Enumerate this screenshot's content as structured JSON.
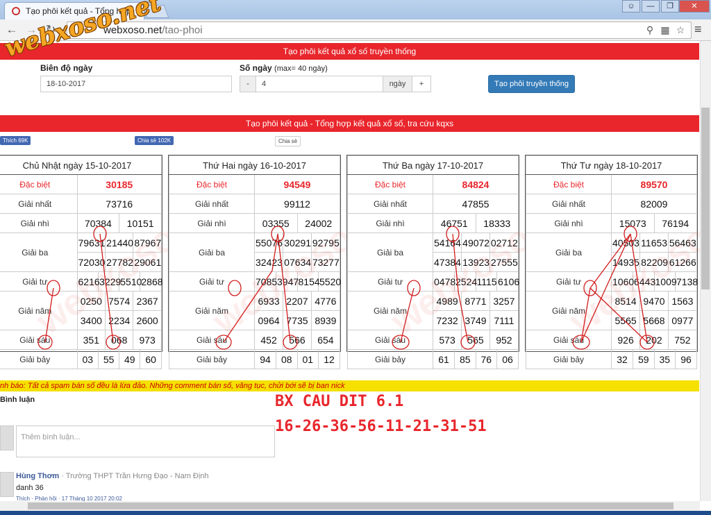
{
  "browser": {
    "tab_title": "Tạo phôi kết quả - Tổng hợp",
    "url_host": "webxoso.net",
    "url_path": "/tao-phoi"
  },
  "form": {
    "banner": "Tạo phôi kết quả xổ số truyền thống",
    "range_label": "Biên độ ngày",
    "range_value": "18-10-2017",
    "days_label": "Số ngày",
    "days_hint": "(max= 40 ngày)",
    "minus": "-",
    "days_value": "4",
    "days_unit": "ngày",
    "plus": "+",
    "submit": "Tạo phôi truyền thống"
  },
  "results_banner": "Tạo phôi kết quả - Tổng hợp kết quả xổ số, tra cứu kqxs",
  "social": {
    "like": "Thích 69K",
    "share": "Chia sẻ 102K",
    "gshare": "Chia sẻ"
  },
  "prize_labels": {
    "db": "Đặc biệt",
    "g1": "Giải nhất",
    "g2": "Giải nhì",
    "g3": "Giải ba",
    "g4": "Giải tư",
    "g5": "Giải năm",
    "g6": "Giải sáu",
    "g7": "Giải bảy"
  },
  "days": [
    {
      "title": "Chủ Nhật ngày 15-10-2017",
      "db": "30185",
      "g1": "73716",
      "g2": [
        "70384",
        "10151"
      ],
      "g3": [
        "79631",
        "21440",
        "87967",
        "72030",
        "27782",
        "29061"
      ],
      "g4": [
        "6216",
        "3229",
        "5510",
        "2868"
      ],
      "g5": [
        "0250",
        "7574",
        "2367",
        "3400",
        "2234",
        "2600"
      ],
      "g6": [
        "351",
        "068",
        "973"
      ],
      "g7": [
        "03",
        "55",
        "49",
        "60"
      ]
    },
    {
      "title": "Thứ Hai ngày 16-10-2017",
      "db": "94549",
      "g1": "99112",
      "g2": [
        "03355",
        "24002"
      ],
      "g3": [
        "55076",
        "30291",
        "92795",
        "32423",
        "07634",
        "73277"
      ],
      "g4": [
        "7085",
        "3947",
        "8154",
        "5520"
      ],
      "g5": [
        "6933",
        "2207",
        "4776",
        "0964",
        "7735",
        "8939"
      ],
      "g6": [
        "452",
        "566",
        "654"
      ],
      "g7": [
        "94",
        "08",
        "01",
        "12"
      ]
    },
    {
      "title": "Thứ Ba ngày 17-10-2017",
      "db": "84824",
      "g1": "47855",
      "g2": [
        "46751",
        "18333"
      ],
      "g3": [
        "54164",
        "49072",
        "02712",
        "47384",
        "13923",
        "27555"
      ],
      "g4": [
        "0478",
        "2524",
        "1115",
        "6106"
      ],
      "g5": [
        "4989",
        "8771",
        "3257",
        "7232",
        "3749",
        "7111"
      ],
      "g6": [
        "573",
        "565",
        "952"
      ],
      "g7": [
        "61",
        "85",
        "76",
        "06"
      ]
    },
    {
      "title": "Thứ Tư ngày 18-10-2017",
      "db": "89570",
      "g1": "82009",
      "g2": [
        "15073",
        "76194"
      ],
      "g3": [
        "40503",
        "11653",
        "56463",
        "14935",
        "82209",
        "61266"
      ],
      "g4": [
        "1060",
        "6443",
        "1009",
        "7138"
      ],
      "g5": [
        "8514",
        "9470",
        "1563",
        "5565",
        "5668",
        "0977"
      ],
      "g6": [
        "926",
        "202",
        "752"
      ],
      "g7": [
        "32",
        "59",
        "35",
        "96"
      ]
    }
  ],
  "watermark": "webxoso.net",
  "overlay": {
    "logo": "webxoso.net",
    "line1": "BX CAU DIT 6.1",
    "line2": "16-26-36-56-11-21-31-51"
  },
  "comments": {
    "warning": "nh báo: Tất cả spam bán số đều là lừa đảo. Những comment bán số, văng tục, chửi bới sẽ bị ban nick",
    "title": "Bình luận",
    "placeholder": "Thêm bình luận...",
    "author": "Hùng Thơm",
    "school": "· Trường THPT Trần Hưng Đạo - Nam Định",
    "text": "danh 36",
    "meta": "Thích · Phản hồi · 17 Tháng 10 2017 20:02"
  },
  "colors": {
    "brand_red": "#e8262c",
    "button_blue": "#337ab7",
    "warning_yellow": "#f5e000"
  }
}
